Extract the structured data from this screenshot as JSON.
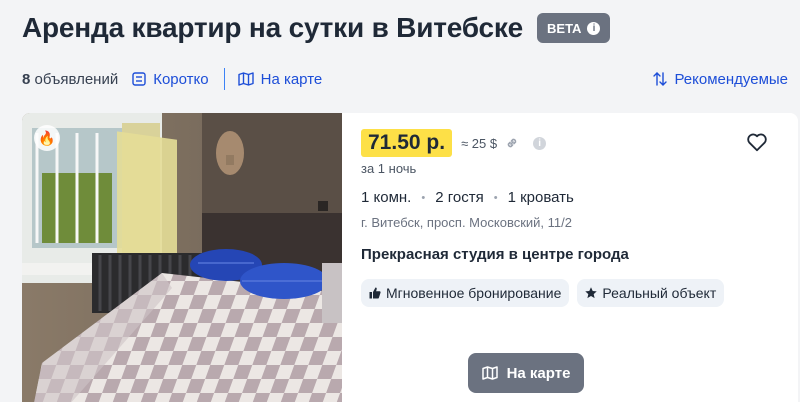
{
  "header": {
    "title": "Аренда квартир на сутки в Витебске",
    "badge": "BETA",
    "badge_icon": "info-icon"
  },
  "toolbar": {
    "count_number": "8",
    "count_label": "объявлений",
    "compact_label": "Коротко",
    "map_label": "На карте",
    "sort_label": "Рекомендуемые",
    "link_color": "#1d4ed8"
  },
  "listing": {
    "price": "71.50 р.",
    "usd": "≈ 25 $",
    "per_night": "за 1 ночь",
    "rooms": "1 комн.",
    "guests": "2 гостя",
    "beds": "1 кровать",
    "address": "г. Витебск, просп. Московский, 11/2",
    "name": "Прекрасная студия в центре города",
    "tags": [
      {
        "label": "Мгновенное бронирование",
        "icon": "thumbs-up-icon"
      },
      {
        "label": "Реальный объект",
        "icon": "star-icon"
      }
    ],
    "map_button": "На карте",
    "price_color": "#fde047"
  }
}
